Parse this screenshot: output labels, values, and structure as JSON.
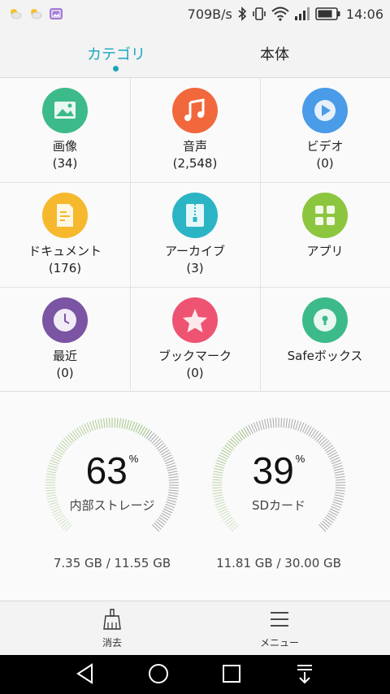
{
  "status_bar": {
    "speed": "709B/s",
    "time": "14:06",
    "icons": [
      "weather-icon",
      "weather-icon",
      "gallery-notification-icon",
      "bluetooth-icon",
      "vibrate-icon",
      "wifi-icon",
      "signal-icon",
      "battery-icon"
    ]
  },
  "tabs": [
    {
      "label": "カテゴリ",
      "active": true
    },
    {
      "label": "本体",
      "active": false
    }
  ],
  "categories": [
    {
      "name": "画像",
      "count": "(34)",
      "icon": "image-icon",
      "color": "#3dba8a"
    },
    {
      "name": "音声",
      "count": "(2,548)",
      "icon": "music-icon",
      "color": "#f2683d"
    },
    {
      "name": "ビデオ",
      "count": "(0)",
      "icon": "video-icon",
      "color": "#4a9be8"
    },
    {
      "name": "ドキュメント",
      "count": "(176)",
      "icon": "document-icon",
      "color": "#f6b82d"
    },
    {
      "name": "アーカイブ",
      "count": "(3)",
      "icon": "archive-icon",
      "color": "#2bb5c4"
    },
    {
      "name": "アプリ",
      "count": "",
      "icon": "apps-icon",
      "color": "#8cc63e"
    },
    {
      "name": "最近",
      "count": "(0)",
      "icon": "clock-icon",
      "color": "#7b54a3"
    },
    {
      "name": "ブックマーク",
      "count": "(0)",
      "icon": "star-icon",
      "color": "#ee5472"
    },
    {
      "name": "Safeボックス",
      "count": "",
      "icon": "safe-lock-icon",
      "color": "#3dba8a"
    }
  ],
  "storage": {
    "internal": {
      "percent": "63",
      "percent_sign": "%",
      "label": "内部ストレージ",
      "usage": "7.35 GB / 11.55 GB",
      "fraction": 0.63
    },
    "sd": {
      "percent": "39",
      "percent_sign": "%",
      "label": "SDカード",
      "usage": "11.81 GB / 30.00 GB",
      "fraction": 0.39
    }
  },
  "bottom_bar": {
    "clear_label": "消去",
    "menu_label": "メニュー"
  },
  "colors": {
    "accent": "#19a6bc",
    "gauge_used": "#9bc07a",
    "gauge_free": "#9a9a9a"
  }
}
